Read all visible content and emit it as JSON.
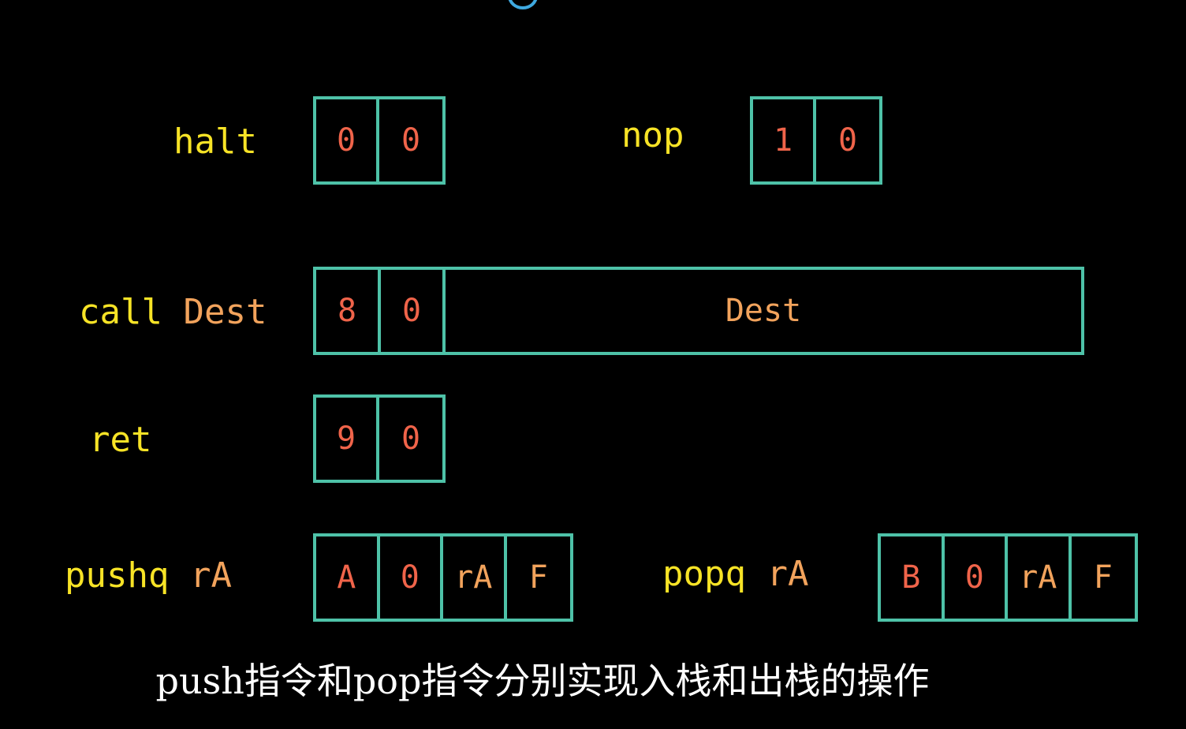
{
  "instructions": [
    {
      "id": "halt",
      "mnemonic": "halt",
      "args": "",
      "bytes": [
        "0",
        "0"
      ]
    },
    {
      "id": "nop",
      "mnemonic": "nop",
      "args": "",
      "bytes": [
        "1",
        "0"
      ]
    },
    {
      "id": "call",
      "mnemonic": "call",
      "args": "Dest",
      "bytes": [
        "8",
        "0"
      ],
      "wide_field": "Dest"
    },
    {
      "id": "ret",
      "mnemonic": "ret",
      "args": "",
      "bytes": [
        "9",
        "0"
      ]
    },
    {
      "id": "pushq",
      "mnemonic": "pushq",
      "args": "rA",
      "bytes": [
        "A",
        "0",
        "rA",
        "F"
      ]
    },
    {
      "id": "popq",
      "mnemonic": "popq",
      "args": "rA",
      "bytes": [
        "B",
        "0",
        "rA",
        "F"
      ]
    }
  ],
  "caption": "push指令和pop指令分别实现入栈和出栈的操作",
  "colors": {
    "background": "#000000",
    "mnemonic": "#f7e326",
    "argument": "#f2a35c",
    "opcode_digit": "#f0644a",
    "box_border": "#4ec2a8",
    "caption": "#ffffff",
    "top_decoration": "#3fa9e0"
  }
}
